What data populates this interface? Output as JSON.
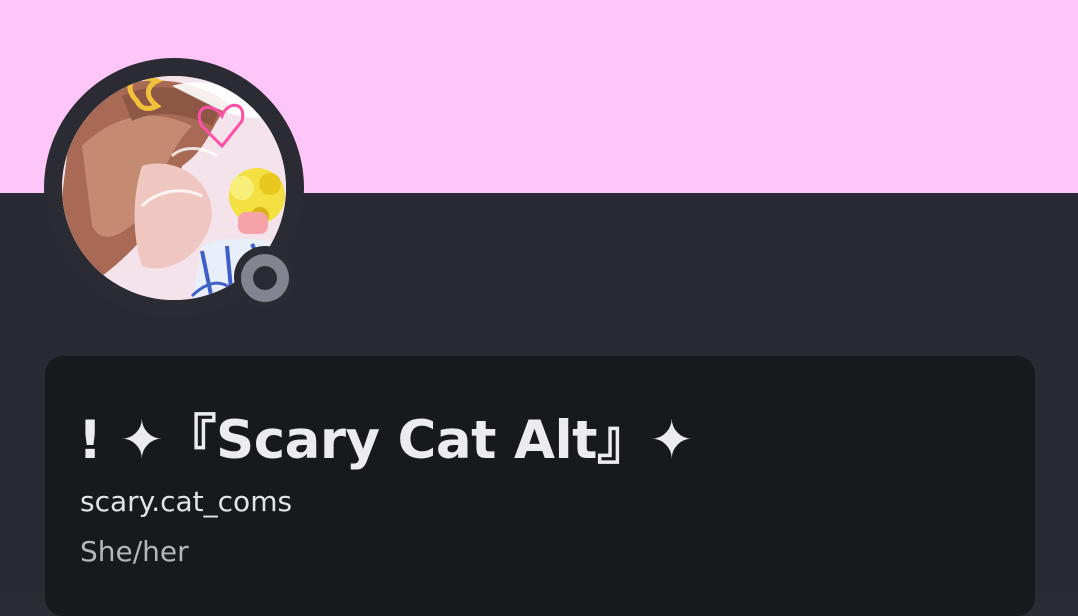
{
  "profile": {
    "display_name": "! ✦『Scary Cat Alt』✦",
    "username": "scary.cat_coms",
    "pronouns": "She/her",
    "status": "offline",
    "avatar_icon": "avatar-artwork",
    "status_icon": "offline-status-icon"
  },
  "colors": {
    "banner": "#fec5f8",
    "background": "#292a33",
    "card": "#18191d",
    "status_offline": "#82858f"
  }
}
